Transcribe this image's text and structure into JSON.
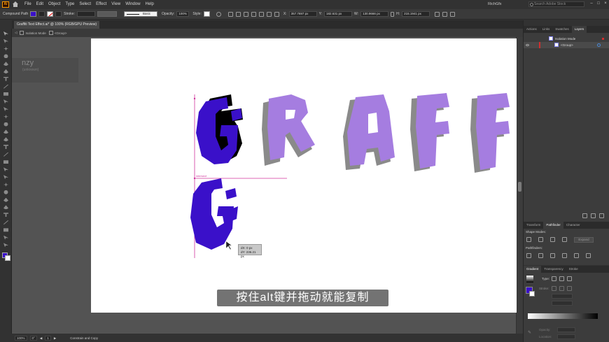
{
  "app": {
    "logo": "Ai",
    "menu": [
      "File",
      "Edit",
      "Object",
      "Type",
      "Select",
      "Effect",
      "View",
      "Window",
      "Help"
    ],
    "user": "RichGfx",
    "search_placeholder": "Search Adobe Stock"
  },
  "control_bar": {
    "selection_type": "Compound Path",
    "stroke_label": "Stroke:",
    "brush": "Basic",
    "opacity_label": "Opacity:",
    "opacity_value": "100%",
    "style_label": "Style:",
    "x_label": "X:",
    "x_value": "357.7697 px",
    "y_label": "Y:",
    "y_value": "182.631 px",
    "w_label": "W:",
    "w_value": "130.9666 px",
    "h_label": "H:",
    "h_value": "215.1941 px",
    "fill_color": "#3a10c9"
  },
  "document": {
    "tab": "Graffiti Text Effect.ai* @ 100% (RGB/GPU Preview)",
    "breadcrumb_layer": "Isolation Mode",
    "breadcrumb_group": "<Group>",
    "ghost_text": "nzy",
    "ghost_sub": "(unknown)"
  },
  "canvas": {
    "smart_guide_label": "intersect",
    "tooltip_dx": "dX: 0 px",
    "tooltip_dy": "dY: 236.21 px",
    "subtitle": "按住alt键并拖动就能复制",
    "colors": {
      "purple_dark": "#3a10c9",
      "purple_light": "#a57de0",
      "shadow_gray": "#8a8a8a",
      "guide_magenta": "#d0359c"
    }
  },
  "status": {
    "zoom": "100%",
    "rotation": "0°",
    "artboard_num": "1",
    "tool_status": "Constrain and Copy"
  },
  "panels": {
    "top_tabs": [
      "Actions",
      "Links",
      "Swatches",
      "Layers"
    ],
    "layers": [
      {
        "name": "Isolation Mode"
      },
      {
        "name": "<Group>"
      }
    ],
    "mid_tabs": [
      "Transform",
      "Pathfinder",
      "Character"
    ],
    "shape_modes_label": "Shape Modes:",
    "expand_label": "Expand",
    "pathfinders_label": "Pathfinders:",
    "bottom_tabs": [
      "Gradient",
      "Transparency",
      "Stroke"
    ],
    "type_label": "Type:",
    "stroke_label": "Stroke:",
    "opacity_label": "Opacity:",
    "location_label": "Location:"
  }
}
